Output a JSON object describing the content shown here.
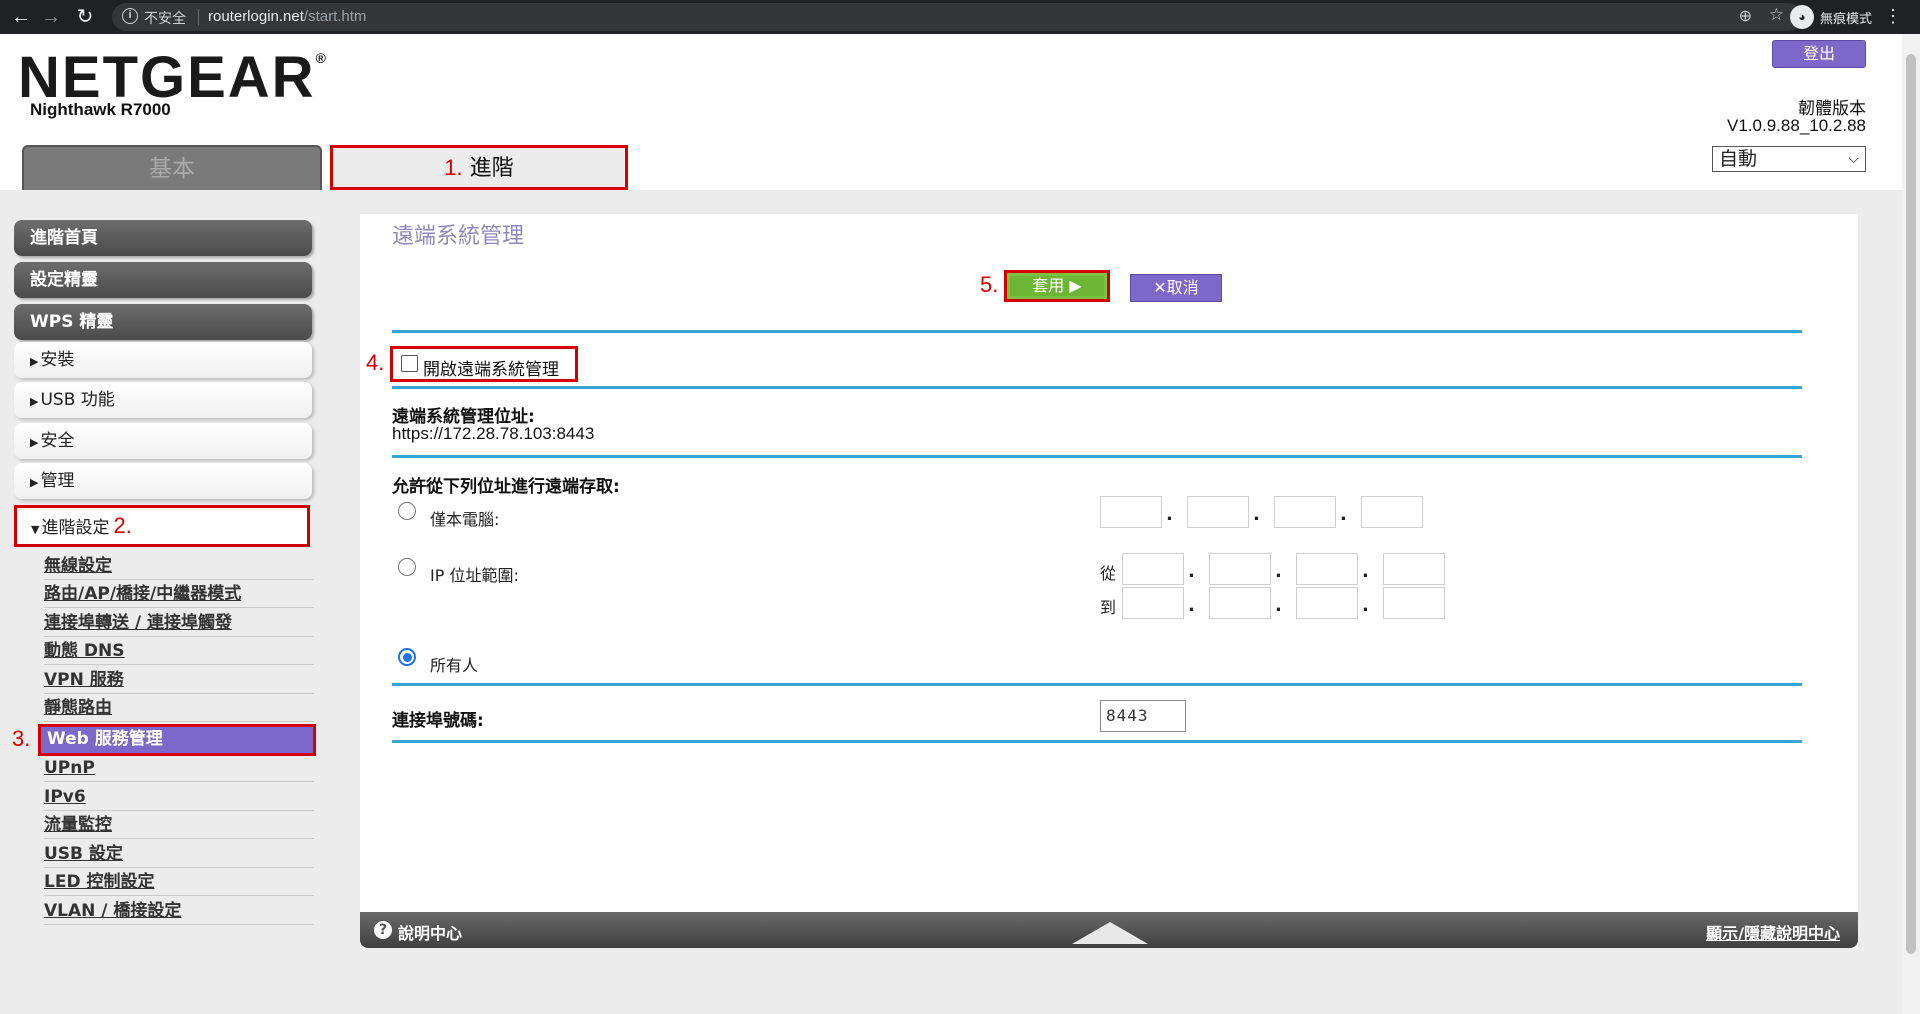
{
  "browser": {
    "insecure_label": "不安全",
    "url_host": "routerlogin.net",
    "url_path": "/start.htm",
    "incognito_label": "無痕模式"
  },
  "header": {
    "brand": "NETGEAR",
    "model": "Nighthawk R7000",
    "logout_label": "登出",
    "firmware_label": "韌體版本",
    "firmware_version": "V1.0.9.88_10.2.88",
    "language_selected": "自動"
  },
  "tabs": {
    "basic": "基本",
    "advanced_step": "1.",
    "advanced": "進階"
  },
  "sidebar": {
    "main_buttons": [
      "進階首頁",
      "設定精靈",
      "WPS 精靈"
    ],
    "sections": [
      "安裝",
      "USB 功能",
      "安全",
      "管理"
    ],
    "open_section": "進階設定",
    "open_section_step": "2.",
    "sub_items": [
      "無線設定",
      "路由/AP/橋接/中繼器模式",
      "連接埠轉送 / 連接埠觸發",
      "動態 DNS",
      "VPN 服務",
      "靜態路由"
    ],
    "active_step": "3.",
    "active_item": "Web 服務管理",
    "sub_items_after": [
      "UPnP",
      "IPv6",
      "流量監控",
      "USB 設定",
      "LED 控制設定",
      "VLAN / 橋接設定"
    ]
  },
  "content": {
    "title": "遠端系統管理",
    "apply_step": "5.",
    "apply_label": "套用 ▶",
    "cancel_label": "✕取消",
    "enable_step": "4.",
    "enable_label": "開啟遠端系統管理",
    "address_label": "遠端系統管理位址:",
    "address_value": "https://172.28.78.103:8443",
    "allow_label": "允許從下列位址進行遠端存取:",
    "opt_single": "僅本電腦:",
    "opt_range": "IP 位址範圍:",
    "range_from": "從",
    "range_to": "到",
    "opt_everyone": "所有人",
    "port_label": "連接埠號碼:",
    "port_value": "8443"
  },
  "help": {
    "label": "說明中心",
    "toggle": "顯示/隱藏說明中心"
  }
}
